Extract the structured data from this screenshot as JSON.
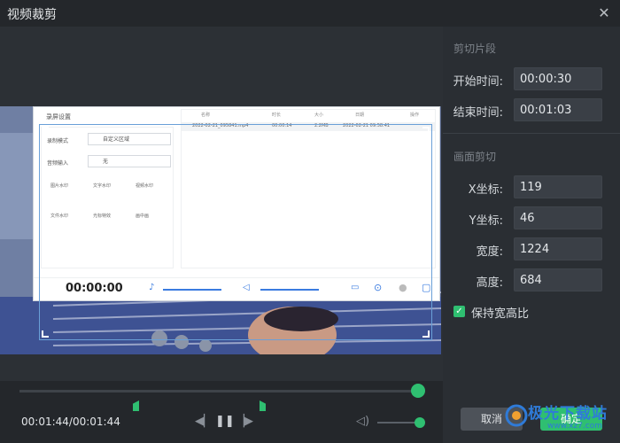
{
  "window": {
    "title": "视频裁剪",
    "close_icon": "close-icon"
  },
  "video_ui": {
    "screen_settings": "录屏设置",
    "record_mode_label": "录制模式",
    "record_mode_value": "自定义区域",
    "audio_input_label": "音频输入",
    "audio_input_value": "无",
    "timer": "00:00:00",
    "tools": [
      "图片水印",
      "文字水印",
      "视频水印",
      "文件水印",
      "光标特效",
      "画中画"
    ],
    "table_headers": [
      "名称",
      "时长",
      "大小",
      "日期",
      "操作"
    ],
    "file_row": [
      "2022-02-21_095841.mp4",
      "00:00:14",
      "2.2MB",
      "2022-02-21 09:58:41"
    ]
  },
  "timeline": {
    "time": "00:01:44/00:01:44",
    "progress": 1.0,
    "volume": 1.0
  },
  "sidebar": {
    "clip_section": "剪切片段",
    "start_label": "开始时间:",
    "start_value": "00:00:30",
    "end_label": "结束时间:",
    "end_value": "00:01:03",
    "crop_section": "画面剪切",
    "x_label": "X坐标:",
    "x_value": "119",
    "y_label": "Y坐标:",
    "y_value": "46",
    "width_label": "宽度:",
    "width_value": "1224",
    "height_label": "高度:",
    "height_value": "684",
    "keep_ratio_label": "保持宽高比",
    "keep_ratio_checked": true,
    "cancel_label": "取消",
    "ok_label": "确定"
  },
  "watermark": {
    "brand": "极光下载站",
    "url": "www.xz7.com"
  },
  "colors": {
    "accent": "#2fbf71",
    "panel": "#2a2e33",
    "crop_border": "#6aa0d8"
  }
}
